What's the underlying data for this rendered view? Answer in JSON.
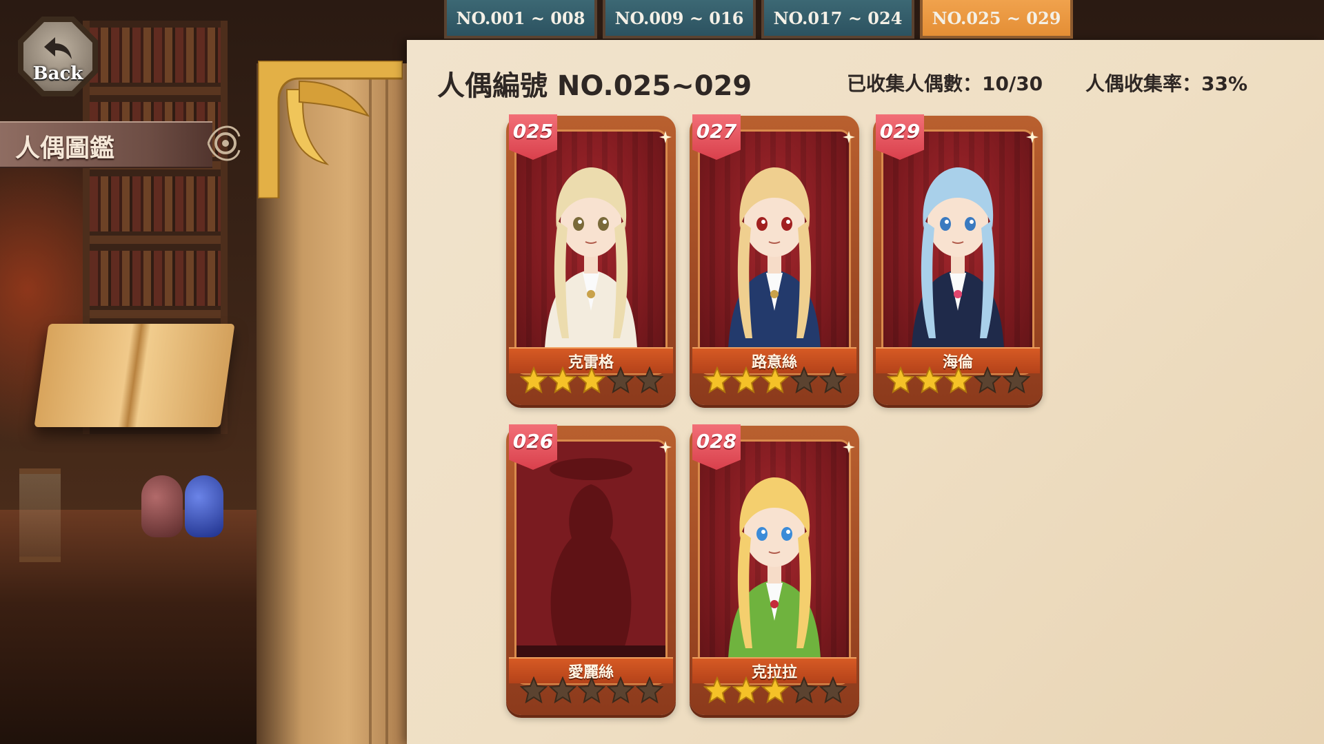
{
  "back": {
    "label": "Back"
  },
  "side_title": "人偶圖鑑",
  "tabs": [
    {
      "label": "NO.001 ~ 008",
      "active": false
    },
    {
      "label": "NO.009 ~ 016",
      "active": false
    },
    {
      "label": "NO.017 ~ 024",
      "active": false
    },
    {
      "label": "NO.025 ~ 029",
      "active": true
    }
  ],
  "header": {
    "title": "人偶編號 NO.025~029",
    "collected": "已收集人偶數：10/30",
    "rate": "人偶收集率：33%"
  },
  "cards": [
    {
      "number": "025",
      "name": "克雷格",
      "stars": 3,
      "max_stars": 5,
      "unlocked": true,
      "palette": {
        "hair": "#ecdcae",
        "outfit": "#f3ecde",
        "accent": "#c9a24a",
        "eyes": "#7a6a3a"
      }
    },
    {
      "number": "027",
      "name": "路意絲",
      "stars": 3,
      "max_stars": 5,
      "unlocked": true,
      "palette": {
        "hair": "#efcf8f",
        "outfit": "#233a6c",
        "accent": "#c9a24a",
        "eyes": "#a12020"
      }
    },
    {
      "number": "029",
      "name": "海倫",
      "stars": 3,
      "max_stars": 5,
      "unlocked": true,
      "palette": {
        "hair": "#a9d0ea",
        "outfit": "#1f2a4a",
        "accent": "#e2456e",
        "eyes": "#3a7ac0"
      }
    },
    {
      "number": "026",
      "name": "愛麗絲",
      "stars": 0,
      "max_stars": 5,
      "unlocked": false,
      "palette": {
        "hair": "#6e1a1c",
        "outfit": "#6e1a1c",
        "accent": "#6e1a1c",
        "eyes": "#6e1a1c"
      }
    },
    {
      "number": "028",
      "name": "克拉拉",
      "stars": 3,
      "max_stars": 5,
      "unlocked": true,
      "palette": {
        "hair": "#f4cf6e",
        "outfit": "#6fb33e",
        "accent": "#c42b3a",
        "eyes": "#3b8bd8"
      }
    }
  ],
  "colors": {
    "tab_inactive": "#2c5260",
    "tab_active": "#e48e35",
    "star_filled": "#f5c228",
    "star_empty": "#5b4330",
    "badge": "#e0505a",
    "ribbon": "#c24d1e"
  }
}
